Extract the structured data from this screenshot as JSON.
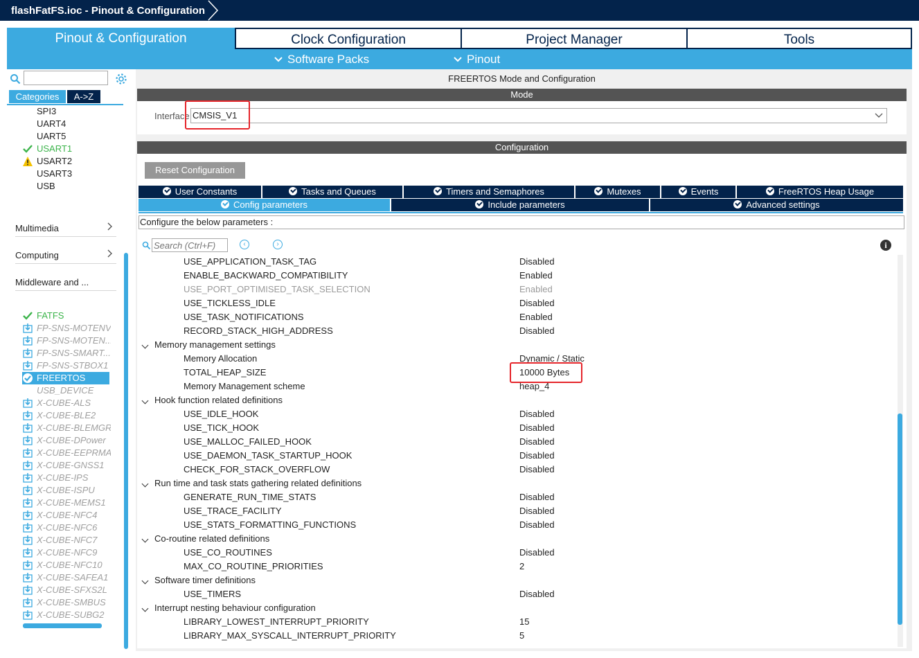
{
  "window": {
    "title": "flashFatFS.ioc - Pinout & Configuration"
  },
  "main_tabs": [
    {
      "label": "Pinout & Configuration",
      "active": true
    },
    {
      "label": "Clock Configuration",
      "active": false
    },
    {
      "label": "Project Manager",
      "active": false
    },
    {
      "label": "Tools",
      "active": false
    }
  ],
  "sub_tabs": [
    {
      "label": "Software Packs",
      "icon": "chevron-down-icon"
    },
    {
      "label": "Pinout",
      "icon": "chevron-down-icon"
    }
  ],
  "sidebar": {
    "search_value": "",
    "category_tabs": [
      {
        "label": "Categories",
        "active": true
      },
      {
        "label": "A->Z",
        "active": false
      }
    ],
    "connectivity_items": [
      {
        "label": "SPI3",
        "status": "none"
      },
      {
        "label": "UART4",
        "status": "none"
      },
      {
        "label": "UART5",
        "status": "none"
      },
      {
        "label": "USART1",
        "status": "ok"
      },
      {
        "label": "USART2",
        "status": "warning"
      },
      {
        "label": "USART3",
        "status": "none"
      },
      {
        "label": "USB",
        "status": "none"
      }
    ],
    "groups": [
      {
        "label": "Multimedia"
      },
      {
        "label": "Computing"
      },
      {
        "label": "Middleware and ..."
      }
    ],
    "middleware_items": [
      {
        "label": "FATFS",
        "status": "ok"
      },
      {
        "label": "FP-SNS-MOTENV",
        "status": "pack"
      },
      {
        "label": "FP-SNS-MOTEN...",
        "status": "pack"
      },
      {
        "label": "FP-SNS-SMART...",
        "status": "pack"
      },
      {
        "label": "FP-SNS-STBOX1",
        "status": "pack"
      },
      {
        "label": "FREERTOS",
        "status": "selected"
      },
      {
        "label": "USB_DEVICE",
        "status": "disabled"
      },
      {
        "label": "X-CUBE-ALS",
        "status": "pack"
      },
      {
        "label": "X-CUBE-BLE2",
        "status": "pack"
      },
      {
        "label": "X-CUBE-BLEMGR",
        "status": "pack"
      },
      {
        "label": "X-CUBE-DPower",
        "status": "pack"
      },
      {
        "label": "X-CUBE-EEPRMA",
        "status": "pack"
      },
      {
        "label": "X-CUBE-GNSS1",
        "status": "pack"
      },
      {
        "label": "X-CUBE-IPS",
        "status": "pack"
      },
      {
        "label": "X-CUBE-ISPU",
        "status": "pack"
      },
      {
        "label": "X-CUBE-MEMS1",
        "status": "pack"
      },
      {
        "label": "X-CUBE-NFC4",
        "status": "pack"
      },
      {
        "label": "X-CUBE-NFC6",
        "status": "pack"
      },
      {
        "label": "X-CUBE-NFC7",
        "status": "pack"
      },
      {
        "label": "X-CUBE-NFC9",
        "status": "pack"
      },
      {
        "label": "X-CUBE-NFC10",
        "status": "pack"
      },
      {
        "label": "X-CUBE-SAFEA1",
        "status": "pack"
      },
      {
        "label": "X-CUBE-SFXS2L",
        "status": "pack"
      },
      {
        "label": "X-CUBE-SMBUS",
        "status": "pack"
      },
      {
        "label": "X-CUBE-SUBG2",
        "status": "pack"
      }
    ]
  },
  "panel": {
    "title": "FREERTOS Mode and Configuration",
    "mode_header": "Mode",
    "interface_label": "Interface",
    "interface_value": "CMSIS_V1",
    "config_header": "Configuration",
    "reset_button": "Reset Configuration",
    "config_tabs_row1": [
      "User Constants",
      "Tasks and Queues",
      "Timers and Semaphores",
      "Mutexes",
      "Events",
      "FreeRTOS Heap Usage"
    ],
    "config_tabs_row2": [
      {
        "label": "Config parameters",
        "active": true
      },
      {
        "label": "Include parameters",
        "active": false
      },
      {
        "label": "Advanced settings",
        "active": false
      }
    ],
    "description": "Configure the below parameters :",
    "search_placeholder": "Search (Ctrl+F)",
    "params": [
      {
        "name": "USE_APPLICATION_TASK_TAG",
        "value": "Disabled"
      },
      {
        "name": "ENABLE_BACKWARD_COMPATIBILITY",
        "value": "Enabled"
      },
      {
        "name": "USE_PORT_OPTIMISED_TASK_SELECTION",
        "value": "Enabled",
        "dim": true
      },
      {
        "name": "USE_TICKLESS_IDLE",
        "value": "Disabled"
      },
      {
        "name": "USE_TASK_NOTIFICATIONS",
        "value": "Enabled"
      },
      {
        "name": "RECORD_STACK_HIGH_ADDRESS",
        "value": "Disabled"
      },
      {
        "name": "Memory management settings",
        "section": true
      },
      {
        "name": "Memory Allocation",
        "value": "Dynamic / Static"
      },
      {
        "name": "TOTAL_HEAP_SIZE",
        "value": "10000 Bytes"
      },
      {
        "name": "Memory Management scheme",
        "value": "heap_4"
      },
      {
        "name": "Hook function related definitions",
        "section": true
      },
      {
        "name": "USE_IDLE_HOOK",
        "value": "Disabled"
      },
      {
        "name": "USE_TICK_HOOK",
        "value": "Disabled"
      },
      {
        "name": "USE_MALLOC_FAILED_HOOK",
        "value": "Disabled"
      },
      {
        "name": "USE_DAEMON_TASK_STARTUP_HOOK",
        "value": "Disabled"
      },
      {
        "name": "CHECK_FOR_STACK_OVERFLOW",
        "value": "Disabled"
      },
      {
        "name": "Run time and task stats gathering related definitions",
        "section": true
      },
      {
        "name": "GENERATE_RUN_TIME_STATS",
        "value": "Disabled"
      },
      {
        "name": "USE_TRACE_FACILITY",
        "value": "Disabled"
      },
      {
        "name": "USE_STATS_FORMATTING_FUNCTIONS",
        "value": "Disabled"
      },
      {
        "name": "Co-routine related definitions",
        "section": true
      },
      {
        "name": "USE_CO_ROUTINES",
        "value": "Disabled"
      },
      {
        "name": "MAX_CO_ROUTINE_PRIORITIES",
        "value": "2"
      },
      {
        "name": "Software timer definitions",
        "section": true
      },
      {
        "name": "USE_TIMERS",
        "value": "Disabled"
      },
      {
        "name": "Interrupt nesting behaviour configuration",
        "section": true
      },
      {
        "name": "LIBRARY_LOWEST_INTERRUPT_PRIORITY",
        "value": "15"
      },
      {
        "name": "LIBRARY_MAX_SYSCALL_INTERRUPT_PRIORITY",
        "value": "5"
      }
    ]
  },
  "colors": {
    "navy": "#03234b",
    "accent": "#3caae0",
    "ok_green": "#3cb44b",
    "highlight_red": "#e5242a",
    "header_gray": "#545454"
  }
}
